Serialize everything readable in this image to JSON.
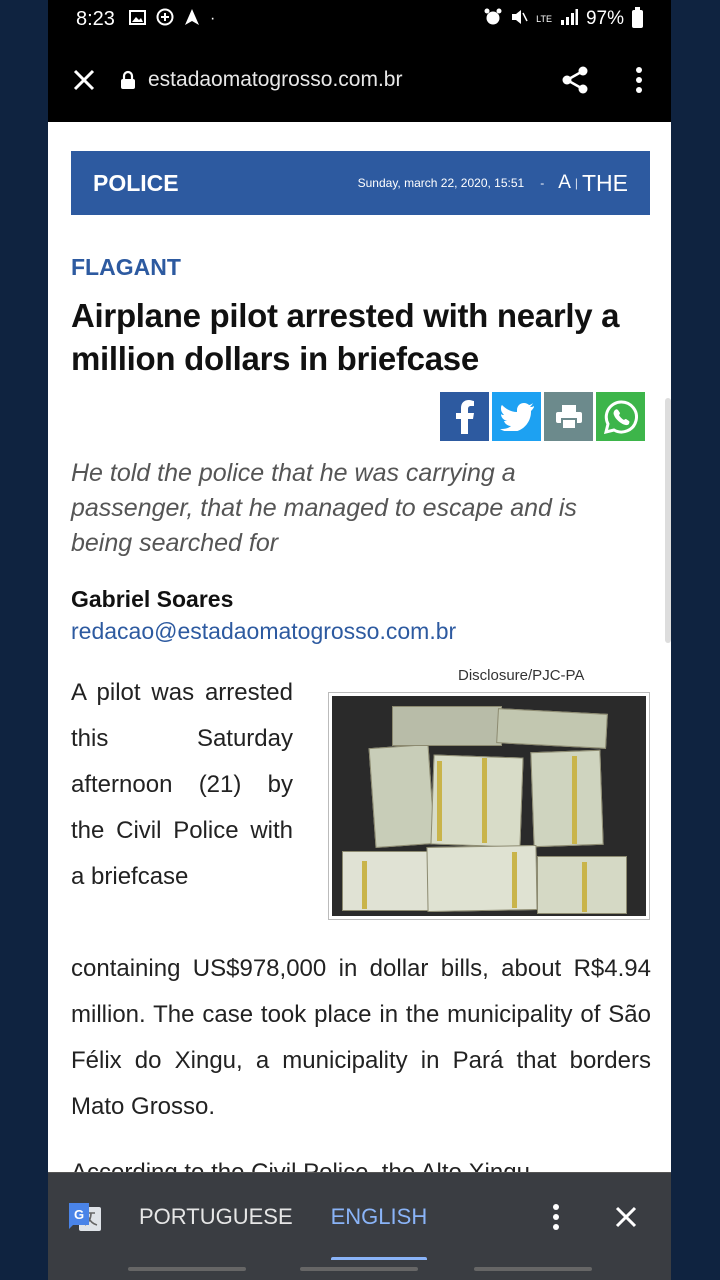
{
  "status_bar": {
    "time": "8:23",
    "battery": "97%",
    "network": "LTE"
  },
  "browser": {
    "url": "estadaomatogrosso.com.br"
  },
  "article": {
    "section": "POLICE",
    "date": "Sunday, march 22, 2020, 15:51",
    "separator": "-",
    "font_small": "A",
    "font_large": "THE",
    "kicker": "FLAGANT",
    "headline": "Airplane pilot arrested with nearly a million dollars in briefcase",
    "subtitle": "He told the police that he was carrying a passenger, that he managed to escape and is being searched for",
    "author": "Gabriel Soares",
    "email": "redacao@estadaomatogrosso.com.br",
    "photo_credit": "Disclosure/PJC-PA",
    "body_left": "A pilot was arrested this Saturday afternoon (21) by the Civil Police with a briefcase",
    "body_full": "containing US$978,000 in dollar bills, about R$4.94 million. The case took place in the municipality of São Félix do Xingu, a municipality in Pará that borders Mato Grosso.",
    "cutoff_line": "According to the Civil Police, the Alto Xingu"
  },
  "translate_bar": {
    "source_lang": "PORTUGUESE",
    "target_lang": "ENGLISH"
  },
  "colors": {
    "brand": "#2d5aa0",
    "translate_active": "#8ab4f8"
  },
  "icons": [
    "close-icon",
    "lock-icon",
    "share-icon",
    "more-vert-icon",
    "facebook-icon",
    "twitter-icon",
    "print-icon",
    "whatsapp-icon",
    "google-translate-icon"
  ]
}
